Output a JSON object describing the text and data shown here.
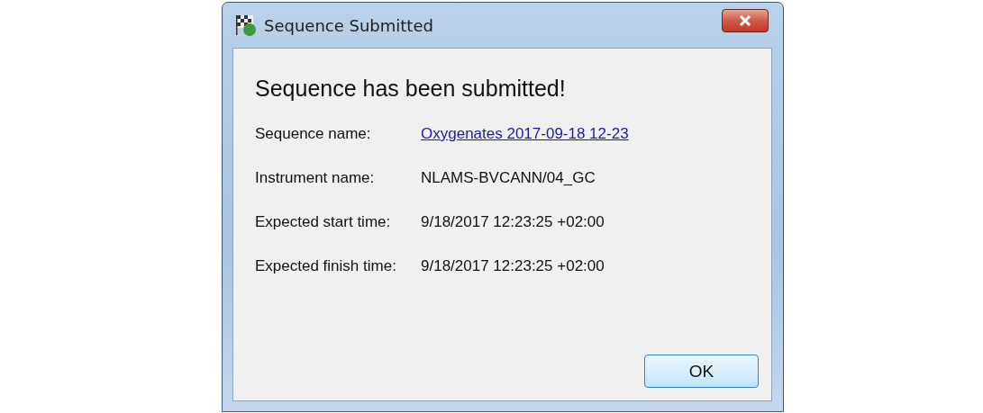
{
  "window": {
    "title": "Sequence Submitted"
  },
  "heading": "Sequence has been submitted!",
  "fields": [
    {
      "label": "Sequence name:",
      "value": "Oxygenates 2017-09-18 12-23",
      "kind": "link"
    },
    {
      "label": "Instrument name:",
      "value": "NLAMS-BVCANN/04_GC",
      "kind": "text"
    },
    {
      "label": "Expected start time:",
      "value": "9/18/2017 12:23:25 +02:00",
      "kind": "text"
    },
    {
      "label": "Expected finish time:",
      "value": "9/18/2017 12:23:25 +02:00",
      "kind": "text"
    }
  ],
  "buttons": [
    "OK"
  ]
}
